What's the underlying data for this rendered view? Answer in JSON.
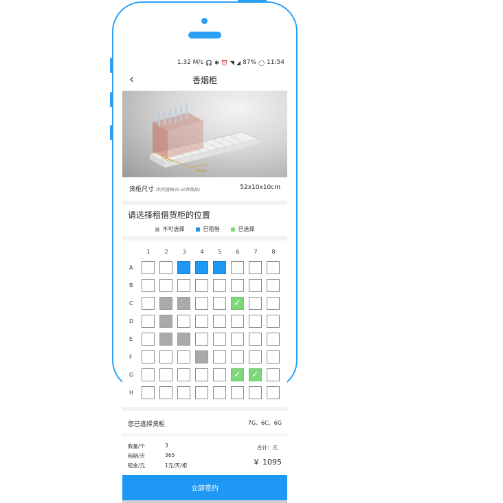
{
  "status_bar": {
    "speed": "1.32 M/s",
    "battery": "87%",
    "time": "11:54"
  },
  "header": {
    "title": "香烟柜"
  },
  "product": {
    "image_labels": {
      "width": "52cm",
      "depth": "10cm"
    },
    "size_label": "货柜尺寸",
    "size_note": "(约可容纳30-50件商品)",
    "size_value": "52x10x10cm"
  },
  "selection": {
    "title": "请选择租借货柜的位置",
    "legend": [
      {
        "label": "不可选择",
        "color": "#aaaaaa"
      },
      {
        "label": "已租借",
        "color": "#1e98f5"
      },
      {
        "label": "已选择",
        "color": "#7ed87a"
      }
    ],
    "columns": [
      "1",
      "2",
      "3",
      "4",
      "5",
      "6",
      "7",
      "8"
    ],
    "rows": [
      {
        "label": "A",
        "cells": [
          "empty",
          "empty",
          "rented",
          "rented",
          "rented",
          "empty",
          "empty",
          "empty"
        ]
      },
      {
        "label": "B",
        "cells": [
          "empty",
          "empty",
          "empty",
          "empty",
          "empty",
          "empty",
          "empty",
          "empty"
        ]
      },
      {
        "label": "C",
        "cells": [
          "empty",
          "sold",
          "sold",
          "empty",
          "empty",
          "selected",
          "empty",
          "empty"
        ]
      },
      {
        "label": "D",
        "cells": [
          "empty",
          "sold",
          "empty",
          "empty",
          "empty",
          "empty",
          "empty",
          "empty"
        ]
      },
      {
        "label": "E",
        "cells": [
          "empty",
          "sold",
          "sold",
          "empty",
          "empty",
          "empty",
          "empty",
          "empty"
        ]
      },
      {
        "label": "F",
        "cells": [
          "empty",
          "empty",
          "empty",
          "sold",
          "empty",
          "empty",
          "empty",
          "empty"
        ]
      },
      {
        "label": "G",
        "cells": [
          "empty",
          "empty",
          "empty",
          "empty",
          "empty",
          "selected",
          "selected",
          "empty"
        ]
      },
      {
        "label": "H",
        "cells": [
          "empty",
          "empty",
          "empty",
          "empty",
          "empty",
          "empty",
          "empty",
          "empty"
        ]
      }
    ]
  },
  "chosen": {
    "label": "您已选择货柜",
    "value": "7G、6C、6G"
  },
  "summary": {
    "rows": [
      {
        "label": "数量/个",
        "value": "3"
      },
      {
        "label": "租期/天",
        "value": "365"
      },
      {
        "label": "租金/元",
        "value": "1元/天/柜"
      }
    ],
    "total_label": "合计：元",
    "total_value": "￥ 1095"
  },
  "action": {
    "sign_label": "立即签约"
  },
  "colors": {
    "accent": "#1e98f5",
    "phone_outline": "#2aa0f5"
  }
}
